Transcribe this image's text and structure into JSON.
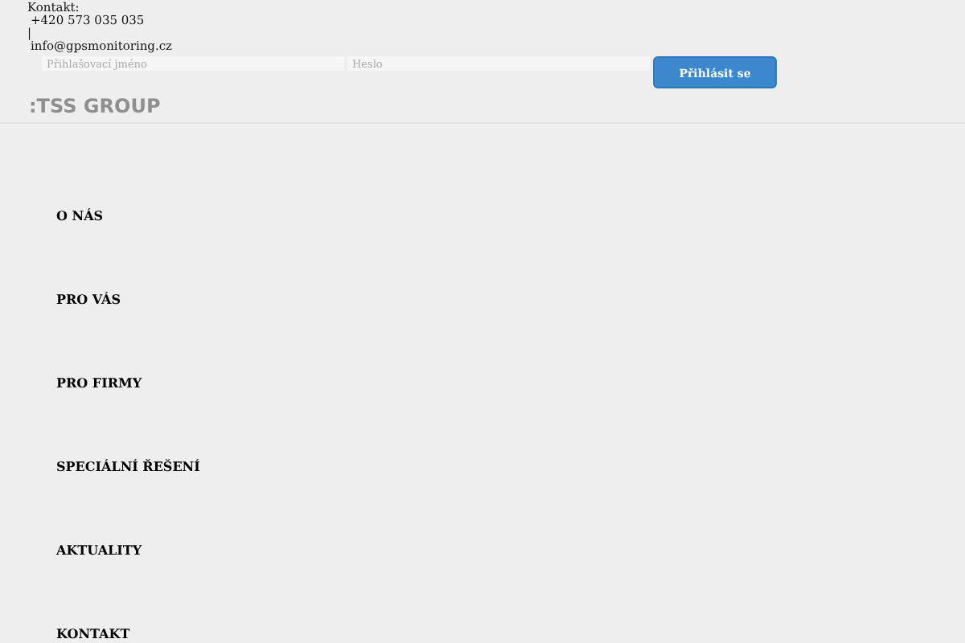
{
  "contact": {
    "label": "Kontakt:",
    "phone": "+420 573 035 035",
    "separator": "|",
    "email": "info@gpsmonitoring.cz"
  },
  "login": {
    "username_placeholder": "Přihlašovací jméno",
    "password_placeholder": "Heslo",
    "button": "Přihlásit se"
  },
  "logo": ":TSS GROUP",
  "menu": [
    {
      "label": "O NÁS"
    },
    {
      "label": "PRO VÁS"
    },
    {
      "label": "PRO FIRMY"
    },
    {
      "label": "SPECIÁLNÍ ŘEŠENÍ"
    },
    {
      "label": "AKTUALITY"
    },
    {
      "label": "KONTAKT"
    }
  ]
}
